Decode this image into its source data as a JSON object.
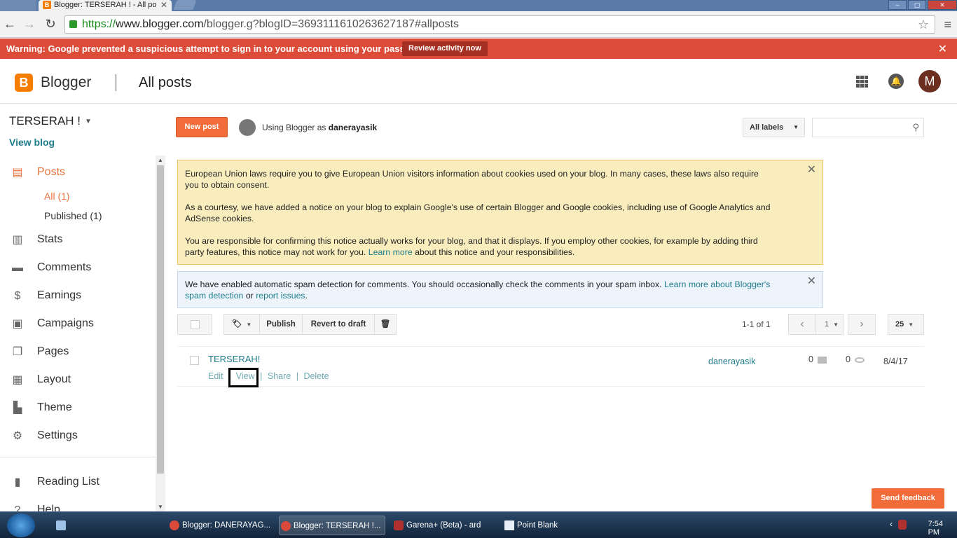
{
  "browser": {
    "tab_title": "Blogger: TERSERAH ! - All po",
    "url_scheme": "https://",
    "url_domain": "www.blogger.com",
    "url_path": "/blogger.g?blogID=3693111610263627187#allposts"
  },
  "warning": {
    "message": "Warning: Google prevented a suspicious attempt to sign in to your account using your password.",
    "button": "Review activity now",
    "close": "✕"
  },
  "header": {
    "logo_letter": "B",
    "brand": "Blogger",
    "page_title": "All posts",
    "avatar_letter": "M"
  },
  "sidebar": {
    "blog_name": "TERSERAH !",
    "view_blog": "View blog",
    "nav": [
      {
        "label": "Posts",
        "icon": "posts-icon"
      },
      {
        "label": "Stats",
        "icon": "stats-icon"
      },
      {
        "label": "Comments",
        "icon": "comments-icon"
      },
      {
        "label": "Earnings",
        "icon": "earnings-icon"
      },
      {
        "label": "Campaigns",
        "icon": "campaigns-icon"
      },
      {
        "label": "Pages",
        "icon": "pages-icon"
      },
      {
        "label": "Layout",
        "icon": "layout-icon"
      },
      {
        "label": "Theme",
        "icon": "theme-icon"
      },
      {
        "label": "Settings",
        "icon": "settings-icon"
      }
    ],
    "sub": [
      {
        "label": "All (1)"
      },
      {
        "label": "Published (1)"
      }
    ],
    "reading_list": "Reading List",
    "help": "Help"
  },
  "main": {
    "new_post": "New post",
    "using_prefix": "Using Blogger as",
    "username": "danerayasik",
    "labels_dropdown": "All labels",
    "search_placeholder": ""
  },
  "notice_eu": {
    "p1": "European Union laws require you to give European Union visitors information about cookies used on your blog. In many cases, these laws also require you to obtain consent.",
    "p2": "As a courtesy, we have added a notice on your blog to explain Google's use of certain Blogger and Google cookies, including use of Google Analytics and AdSense cookies.",
    "p3_a": "You are responsible for confirming this notice actually works for your blog, and that it displays. If you employ other cookies, for example by adding third party features, this notice may not work for you.",
    "p3_link": "Learn more",
    "p3_b": "about this notice and your responsibilities."
  },
  "notice_spam": {
    "text_a": "We have enabled automatic spam detection for comments. You should occasionally check the comments in your spam inbox.",
    "link1": "Learn more about Blogger's spam detection",
    "text_b": "or",
    "link2": "report issues",
    "text_c": "."
  },
  "toolbar": {
    "publish": "Publish",
    "revert": "Revert to draft",
    "range": "1-1 of 1",
    "page": "1",
    "per_page": "25"
  },
  "posts": [
    {
      "title": "TERSERAH!",
      "actions": {
        "edit": "Edit",
        "sep1": "|",
        "view": "View",
        "sep2": "|",
        "share": "Share",
        "sep3": "|",
        "delete": "Delete"
      },
      "author": "danerayasik",
      "comments": "0",
      "views": "0",
      "date": "8/4/17"
    }
  ],
  "feedback": "Send feedback",
  "taskbar": {
    "items": [
      {
        "label": "Blogger: DANERAYAG..."
      },
      {
        "label": "Blogger: TERSERAH !..."
      },
      {
        "label": "Garena+ (Beta) - ard"
      },
      {
        "label": "Point Blank"
      }
    ],
    "clock": "7:54 PM"
  },
  "colors": {
    "accent": "#f26c3a",
    "warning": "#dd4b39",
    "link": "#1e7c8b"
  }
}
